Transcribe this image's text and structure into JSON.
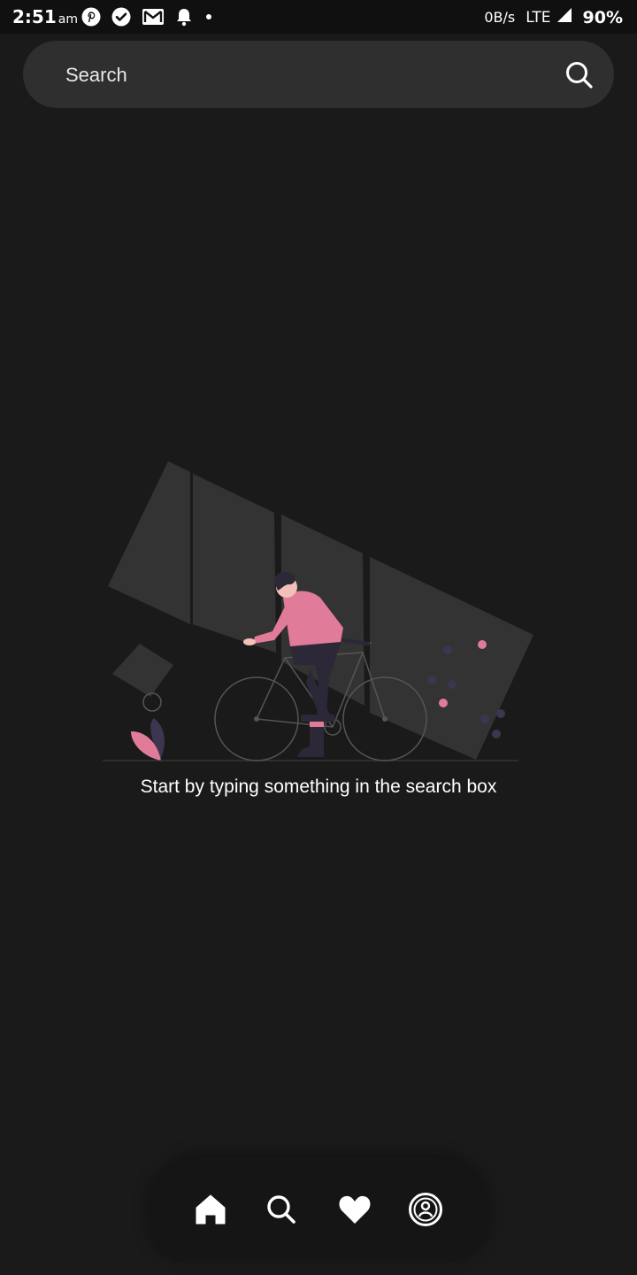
{
  "status_bar": {
    "time": "2:51",
    "ampm": "am",
    "network_speed": "0B/s",
    "network_type": "LTE",
    "battery": "90%",
    "notification_icons": [
      "pinterest-icon",
      "check-circle-icon",
      "gmail-icon",
      "bell-icon",
      "dot-icon"
    ]
  },
  "search": {
    "placeholder": "Search",
    "value": ""
  },
  "empty_state": {
    "message": "Start by typing something in the search box"
  },
  "bottom_nav": {
    "items": [
      {
        "icon": "home-icon"
      },
      {
        "icon": "search-icon"
      },
      {
        "icon": "heart-icon"
      },
      {
        "icon": "profile-icon"
      }
    ]
  },
  "colors": {
    "background": "#1a1a1a",
    "search_bar": "#2f2f2f",
    "accent_pink": "#e07b9a",
    "accent_purple": "#3e3550"
  }
}
